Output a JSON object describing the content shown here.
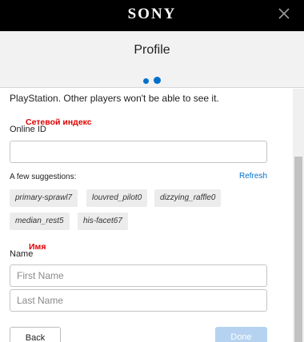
{
  "brand": {
    "logo_text": "SONY"
  },
  "icons": {
    "close": "close-icon"
  },
  "header": {
    "title": "Profile",
    "step_total": 2,
    "step_current": 2
  },
  "intro_text": "PlayStation. Other players won't be able to see it.",
  "online_id": {
    "annotation": "Сетевой индекс",
    "label": "Online ID",
    "value": ""
  },
  "suggestions": {
    "label": "A few suggestions:",
    "refresh_label": "Refresh",
    "items": [
      "primary-sprawl7",
      "louvred_pilot0",
      "dizzying_raffle0",
      "median_rest5",
      "his-facet67"
    ]
  },
  "name": {
    "annotation": "Имя",
    "label": "Name",
    "first_placeholder": "First Name",
    "last_placeholder": "Last Name"
  },
  "buttons": {
    "back": "Back",
    "done": "Done"
  },
  "colors": {
    "accent": "#0070cc",
    "done_disabled": "#b5d2f0",
    "annotation": "#e00000",
    "topbar": "#000000"
  }
}
